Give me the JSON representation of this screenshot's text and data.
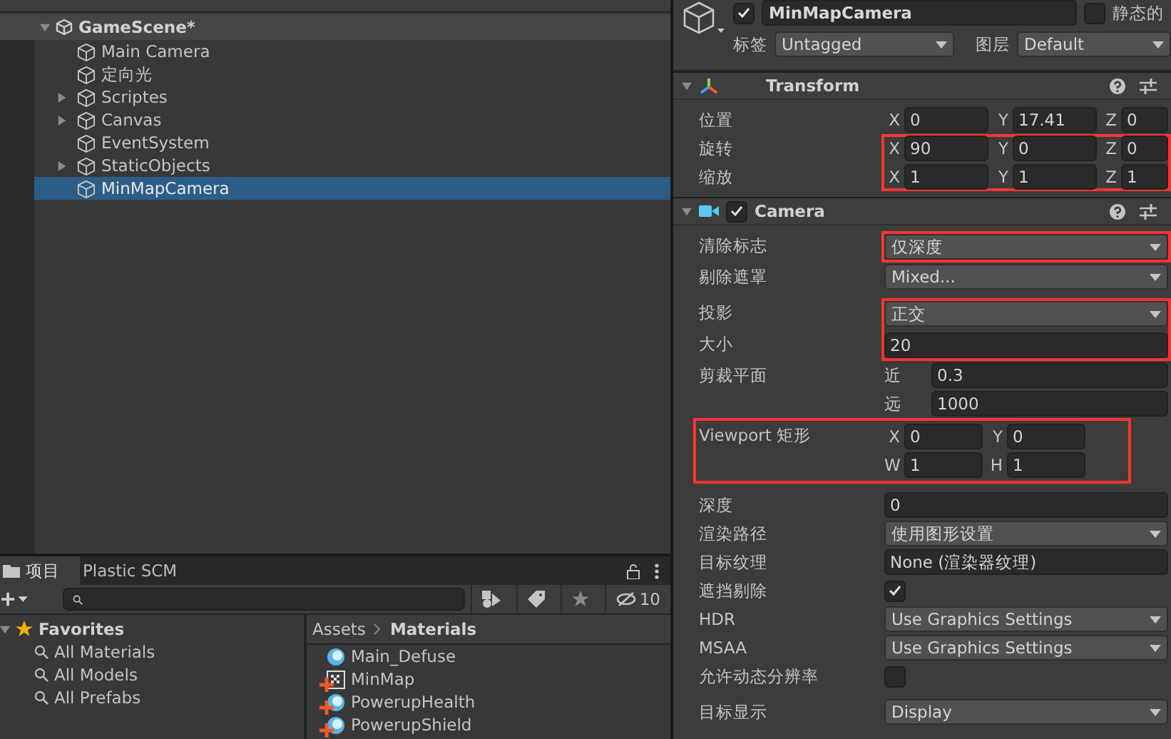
{
  "hierarchy": {
    "scene": "GameScene*",
    "items": [
      {
        "name": "Main Camera",
        "expandable": false,
        "selected": false
      },
      {
        "name": "定向光",
        "expandable": false,
        "selected": false
      },
      {
        "name": "Scriptes",
        "expandable": true,
        "selected": false
      },
      {
        "name": "Canvas",
        "expandable": true,
        "selected": false
      },
      {
        "name": "EventSystem",
        "expandable": false,
        "selected": false
      },
      {
        "name": "StaticObjects",
        "expandable": true,
        "selected": false
      },
      {
        "name": "MinMapCamera",
        "expandable": false,
        "selected": true
      }
    ]
  },
  "project": {
    "tabs": [
      {
        "label": "项目",
        "selected": true
      },
      {
        "label": "Plastic SCM",
        "selected": false
      }
    ],
    "hidden_count": "10",
    "favorites": {
      "title": "Favorites",
      "items": [
        "All Materials",
        "All Models",
        "All Prefabs"
      ]
    },
    "breadcrumb": [
      "Assets",
      "Materials"
    ],
    "assets": [
      {
        "name": "Main_Defuse",
        "kind": "material",
        "added": false
      },
      {
        "name": "MinMap",
        "kind": "texture",
        "added": true
      },
      {
        "name": "PowerupHealth",
        "kind": "material",
        "added": true
      },
      {
        "name": "PowerupShield",
        "kind": "material",
        "added": true
      }
    ]
  },
  "inspector": {
    "enabled": true,
    "name": "MinMapCamera",
    "static_label": "静态的",
    "static": false,
    "tag_label": "标签",
    "tag": "Untagged",
    "layer_label": "图层",
    "layer": "Default",
    "transform": {
      "title": "Transform",
      "rows": [
        {
          "label": "位置",
          "highlight": false,
          "fields": [
            {
              "axis": "X",
              "value": "0"
            },
            {
              "axis": "Y",
              "value": "17.41"
            },
            {
              "axis": "Z",
              "value": "0"
            }
          ]
        },
        {
          "label": "旋转",
          "highlight": true,
          "fields": [
            {
              "axis": "X",
              "value": "90"
            },
            {
              "axis": "Y",
              "value": "0"
            },
            {
              "axis": "Z",
              "value": "0"
            }
          ]
        },
        {
          "label": "缩放",
          "highlight": true,
          "fields": [
            {
              "axis": "X",
              "value": "1"
            },
            {
              "axis": "Y",
              "value": "1"
            },
            {
              "axis": "Z",
              "value": "1"
            }
          ]
        }
      ]
    },
    "camera": {
      "title": "Camera",
      "enabled": true,
      "sections": [
        [
          {
            "kind": "dropdown",
            "label": "清除标志",
            "value": "仅深度",
            "highlight": true
          },
          {
            "kind": "dropdown",
            "label": "剔除遮罩",
            "value": "Mixed...",
            "highlight": false
          }
        ],
        [
          {
            "kind": "dropdown",
            "label": "投影",
            "value": "正交",
            "highlight": true
          },
          {
            "kind": "field",
            "label": "大小",
            "value": "20",
            "highlight": true
          },
          {
            "kind": "pair",
            "label": "剪裁平面",
            "fields": [
              {
                "axis": "近",
                "value": "0.3"
              },
              {
                "axis": "远",
                "value": "1000"
              }
            ],
            "highlight": false
          },
          {
            "kind": "rect",
            "label": "Viewport 矩形",
            "fields": [
              {
                "axis": "X",
                "value": "0"
              },
              {
                "axis": "Y",
                "value": "0"
              },
              {
                "axis": "W",
                "value": "1"
              },
              {
                "axis": "H",
                "value": "1"
              }
            ],
            "highlight": true
          }
        ],
        [
          {
            "kind": "field",
            "label": "深度",
            "value": "0",
            "highlight": false
          },
          {
            "kind": "dropdown",
            "label": "渲染路径",
            "value": "使用图形设置",
            "highlight": false
          },
          {
            "kind": "object",
            "label": "目标纹理",
            "value": "None (渲染器纹理)",
            "highlight": false
          },
          {
            "kind": "checkbox",
            "label": "遮挡剔除",
            "checked": true,
            "highlight": false
          },
          {
            "kind": "dropdown",
            "label": "HDR",
            "value": "Use Graphics Settings",
            "highlight": false
          },
          {
            "kind": "dropdown",
            "label": "MSAA",
            "value": "Use Graphics Settings",
            "highlight": false
          },
          {
            "kind": "checkbox",
            "label": "允许动态分辨率",
            "checked": false,
            "highlight": false
          }
        ],
        [
          {
            "kind": "dropdown",
            "label": "目标显示",
            "value": "Display",
            "highlight": false
          }
        ]
      ]
    }
  }
}
